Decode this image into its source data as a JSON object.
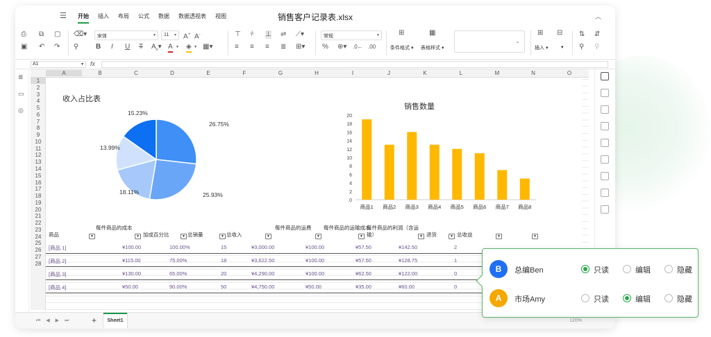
{
  "window": {
    "title": "销售客户记录表.xlsx"
  },
  "menu": {
    "tabs": [
      "开始",
      "插入",
      "布局",
      "公式",
      "数据",
      "数据透视表",
      "视图"
    ],
    "active": 0
  },
  "ribbon": {
    "font_name": "宋体",
    "font_size": "11",
    "number_format": "常规",
    "cond_format_label": "条件格式",
    "table_style_label": "表格样式",
    "insert_label": "插入"
  },
  "formula_bar": {
    "cell_ref": "A1",
    "fx": "fx",
    "content": ""
  },
  "columns": [
    "A",
    "B",
    "C",
    "D",
    "E",
    "F",
    "G",
    "H",
    "I",
    "J",
    "K",
    "L",
    "M",
    "N",
    "O"
  ],
  "rows": [
    "1",
    "2",
    "3",
    "4",
    "5",
    "6",
    "7",
    "8",
    "9",
    "10",
    "11",
    "12",
    "13",
    "14",
    "15",
    "16",
    "17",
    "18",
    "19",
    "20",
    "21",
    "22",
    "23",
    "24",
    "25",
    "26",
    "27",
    "28"
  ],
  "pie": {
    "title": "收入占比表",
    "labels": [
      "26.75%",
      "25.93%",
      "18.11%",
      "13.99%",
      "15.23%"
    ]
  },
  "chart_data": [
    {
      "type": "pie",
      "title": "收入占比表",
      "values": [
        26.75,
        25.93,
        18.11,
        13.99,
        15.23
      ],
      "colors": [
        "#3f8ff7",
        "#6aa6f8",
        "#a6c8fb",
        "#cfe1fd",
        "#0d6ff2"
      ]
    },
    {
      "type": "bar",
      "title": "销售数量",
      "categories": [
        "商品1",
        "商品2",
        "商品3",
        "商品4",
        "商品5",
        "商品6",
        "商品7",
        "商品8"
      ],
      "values": [
        19,
        13,
        16,
        13,
        12,
        11,
        7,
        5
      ],
      "ylim": [
        0,
        20
      ],
      "yticks": [
        0,
        2,
        4,
        6,
        8,
        10,
        12,
        14,
        16,
        18,
        20
      ],
      "color": "#ffb800"
    }
  ],
  "table": {
    "headers": [
      "商品",
      "每件商品的成本",
      "加成百分比",
      "总销量",
      "总收入",
      "每件商品的运费",
      "每件商品的运输成本",
      "每件商品的利润（含运输）",
      "退货",
      "总收益"
    ],
    "rows": [
      [
        "[商品 1]",
        "¥100.00",
        "100.00%",
        "15",
        "¥3,000.00",
        "¥100.00",
        "¥57.50",
        "¥142.50",
        "2"
      ],
      [
        "[商品 2]",
        "¥115.00",
        "75.00%",
        "18",
        "¥3,622.50",
        "¥100.00",
        "¥57.50",
        "¥128.75",
        "1"
      ],
      [
        "[商品 3]",
        "¥130.00",
        "65.00%",
        "20",
        "¥4,290.00",
        "¥100.00",
        "¥62.50",
        "¥122.00",
        "0"
      ],
      [
        "[商品 4]",
        "¥50.00",
        "90.00%",
        "50",
        "¥4,750.00",
        "¥50.00",
        "¥35.00",
        "¥60.00",
        "0"
      ]
    ]
  },
  "sheet": {
    "tab": "Sheet1",
    "zoom": "120%"
  },
  "permissions": [
    {
      "avatar": "B",
      "name": "总编Ben",
      "color": "#1f6ff2",
      "options": [
        "只读",
        "编辑",
        "隐藏"
      ],
      "selected": 0
    },
    {
      "avatar": "A",
      "name": "市场Amy",
      "color": "#f5a800",
      "options": [
        "只读",
        "编辑",
        "隐藏"
      ],
      "selected": 1
    }
  ]
}
